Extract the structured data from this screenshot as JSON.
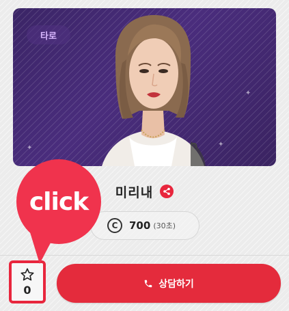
{
  "card": {
    "category_badge": "타로"
  },
  "counselor": {
    "name": "미리내",
    "price": "700",
    "price_unit": "(30초)"
  },
  "actions": {
    "favorite_count": "0",
    "consult_label": "상담하기"
  },
  "callout": {
    "label": "click"
  },
  "colors": {
    "accent": "#e42b3c",
    "card_bg": "#4a2d7d",
    "callout": "#f0334d"
  },
  "icons": [
    "share-icon",
    "coin-icon",
    "star-icon",
    "phone-icon"
  ]
}
